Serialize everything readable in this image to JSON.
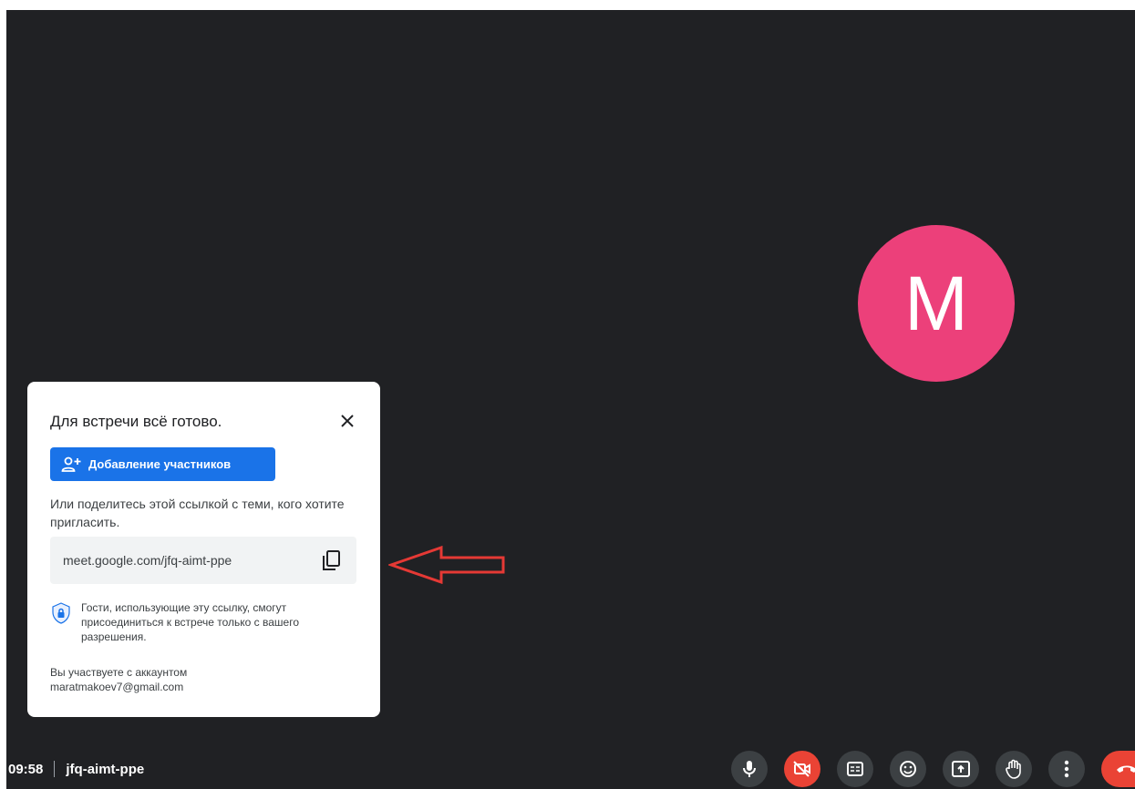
{
  "colors": {
    "stage_bg": "#202124",
    "avatar_bg": "#ec407a",
    "primary_blue": "#1a73e8",
    "danger_red": "#ea4335",
    "annotation_arrow": "#e53935"
  },
  "participant": {
    "initial": "M"
  },
  "panel": {
    "title": "Для встречи всё готово.",
    "close_icon": "close-icon",
    "add_button_label": "Добавление участников",
    "share_text": "Или поделитесь этой ссылкой с теми, кого хотите пригласить.",
    "link": "meet.google.com/jfq-aimt-ppe",
    "guest_note": "Гости, использующие эту ссылку, смогут присоединиться к встрече только с вашего разрешения.",
    "account_line1": "Вы участвуете с аккаунтом",
    "account_line2": "maratmakoev7@gmail.com"
  },
  "footer": {
    "time": "09:58",
    "meeting_code": "jfq-aimt-ppe"
  },
  "controls": [
    {
      "name": "microphone",
      "icon": "mic-icon"
    },
    {
      "name": "camera-off",
      "icon": "camera-off-icon"
    },
    {
      "name": "captions",
      "icon": "captions-icon"
    },
    {
      "name": "reactions",
      "icon": "emoji-icon"
    },
    {
      "name": "present-screen",
      "icon": "present-icon"
    },
    {
      "name": "raise-hand",
      "icon": "hand-icon"
    },
    {
      "name": "more-options",
      "icon": "more-vert-icon"
    },
    {
      "name": "leave-call",
      "icon": "hangup-icon"
    }
  ]
}
